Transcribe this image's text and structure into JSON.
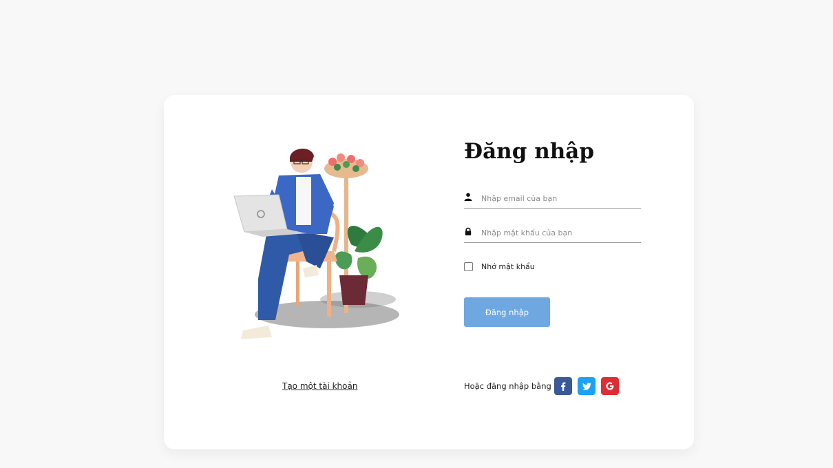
{
  "login": {
    "title": "Đăng nhập",
    "email_placeholder": "Nhập email của bạn",
    "password_placeholder": "Nhập mật khẩu của bạn",
    "remember_label": "Nhớ mật khẩu",
    "submit_label": "Đăng nhập",
    "social_label": "Hoặc đăng nhập bằng",
    "create_account_label": "Tạo một tài khoản"
  },
  "icons": {
    "email": "user-icon",
    "password": "lock-icon",
    "illustration": "man-with-laptop-illustration"
  },
  "social": [
    {
      "name": "facebook",
      "glyph": "f",
      "color": "#3b5998"
    },
    {
      "name": "twitter",
      "glyph": "bird",
      "color": "#1da1f2"
    },
    {
      "name": "google",
      "glyph": "G",
      "color": "#dd2e35"
    }
  ],
  "colors": {
    "background": "#f8f8f8",
    "card": "#ffffff",
    "primary_button": "#6fa8e1"
  }
}
